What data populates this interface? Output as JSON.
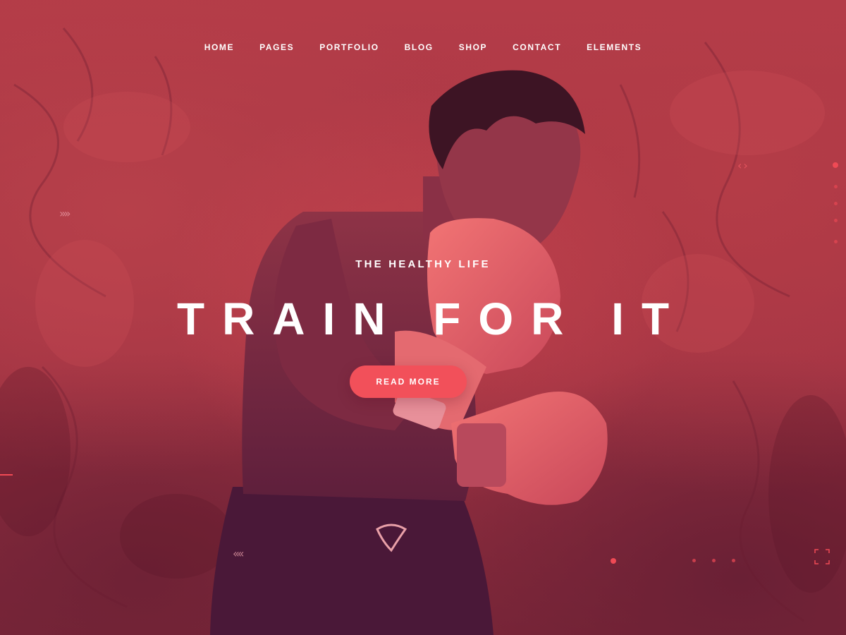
{
  "nav": {
    "items": [
      {
        "label": "HOME"
      },
      {
        "label": "PAGES"
      },
      {
        "label": "PORTFOLIO"
      },
      {
        "label": "BLOG"
      },
      {
        "label": "SHOP"
      },
      {
        "label": "CONTACT"
      },
      {
        "label": "ELEMENTS"
      }
    ]
  },
  "hero": {
    "eyebrow": "THE HEALTHY LIFE",
    "headline": "TRAIN FOR IT",
    "cta_label": "READ MORE",
    "image_subject": "boxer in guard stance with boxing gloves"
  },
  "decorations": {
    "chevrons_right": "»»",
    "chevrons_left": "««",
    "code_brackets": "‹›"
  },
  "colors": {
    "background_red": "#b43c48",
    "background_dark": "#7b2638",
    "accent": "#f2505a",
    "text": "#ffffff"
  }
}
